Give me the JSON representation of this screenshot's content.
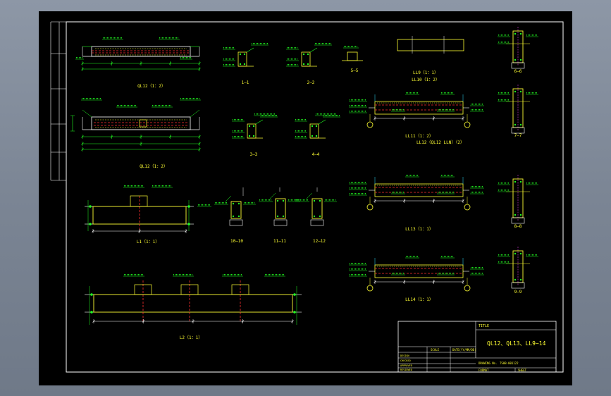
{
  "drawing": {
    "sections": {
      "s1": "1—1",
      "s2": "2—2",
      "s3": "3—3",
      "s4": "4—4",
      "s5": "5—5",
      "s6": "6—6",
      "s7": "7—7",
      "s8": "8—8",
      "s9": "9—9",
      "s10": "10—10",
      "s11": "11—11",
      "s12": "12—12"
    },
    "beams": {
      "ql12_a": "QL12（1：2）",
      "ql12_b": "QL12（1：2）",
      "ll9": "LL9（1：1）",
      "ll10": "LL10（1：2）",
      "ll11": "LL11（1：2）",
      "ll12": "LL12（QL12 LLN）（2）",
      "ll13": "LL13（1：1）",
      "ll14": "LL14（1：1）",
      "l1": "L1（1：1）",
      "l2": "L2（1：1）"
    }
  },
  "title_block": {
    "header": "TITLE",
    "title": "QL12、QL13、LL9~14",
    "col_scale": "SCALE",
    "col_date": "DATE(YY/MM/DD)",
    "drawing_no_label": "DRAWING No.",
    "drawing_no": "TS08-001122",
    "rows": [
      "DESIGN",
      "CHECKED",
      "APPROVED",
      "REVIEWED"
    ],
    "format_label": "FORMAT",
    "sheet_label": "SHEET"
  }
}
